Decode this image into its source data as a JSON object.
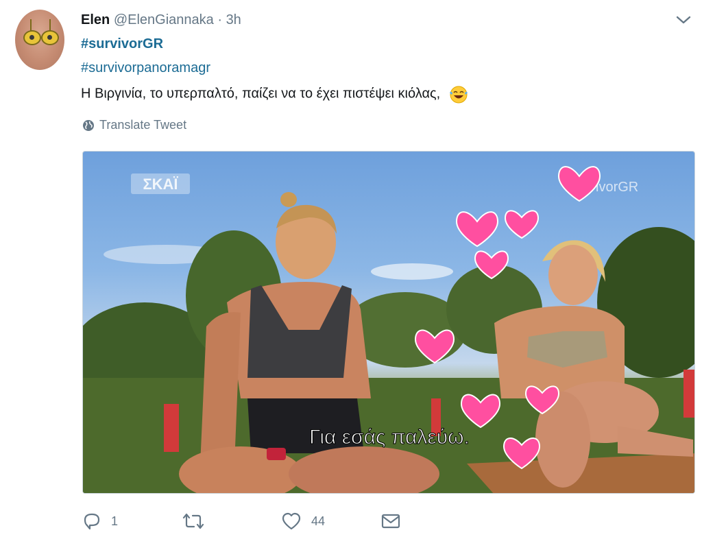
{
  "tweet": {
    "author_name": "Elen",
    "handle": "@ElenGiannaka",
    "separator": "·",
    "time": "3h",
    "hashtags": [
      "#survivorGR",
      "#survivorpanoramagr"
    ],
    "text": "Η Βιργινία, το υπερπαλτό, παίζει να το έχει πιστέψει κιόλας,",
    "emoji": "face-with-tears-of-joy",
    "translate_label": "Translate Tweet"
  },
  "media": {
    "channel_logo": "ΣΚΑΪ",
    "watermark": "ivorGR",
    "subtitle": "Για εσάς παλεύω."
  },
  "actions": {
    "reply_count": "1",
    "retweet_count": "",
    "like_count": "44"
  },
  "colors": {
    "link": "#1b6b94",
    "muted": "#657786",
    "heart": "#ff4fa0"
  }
}
